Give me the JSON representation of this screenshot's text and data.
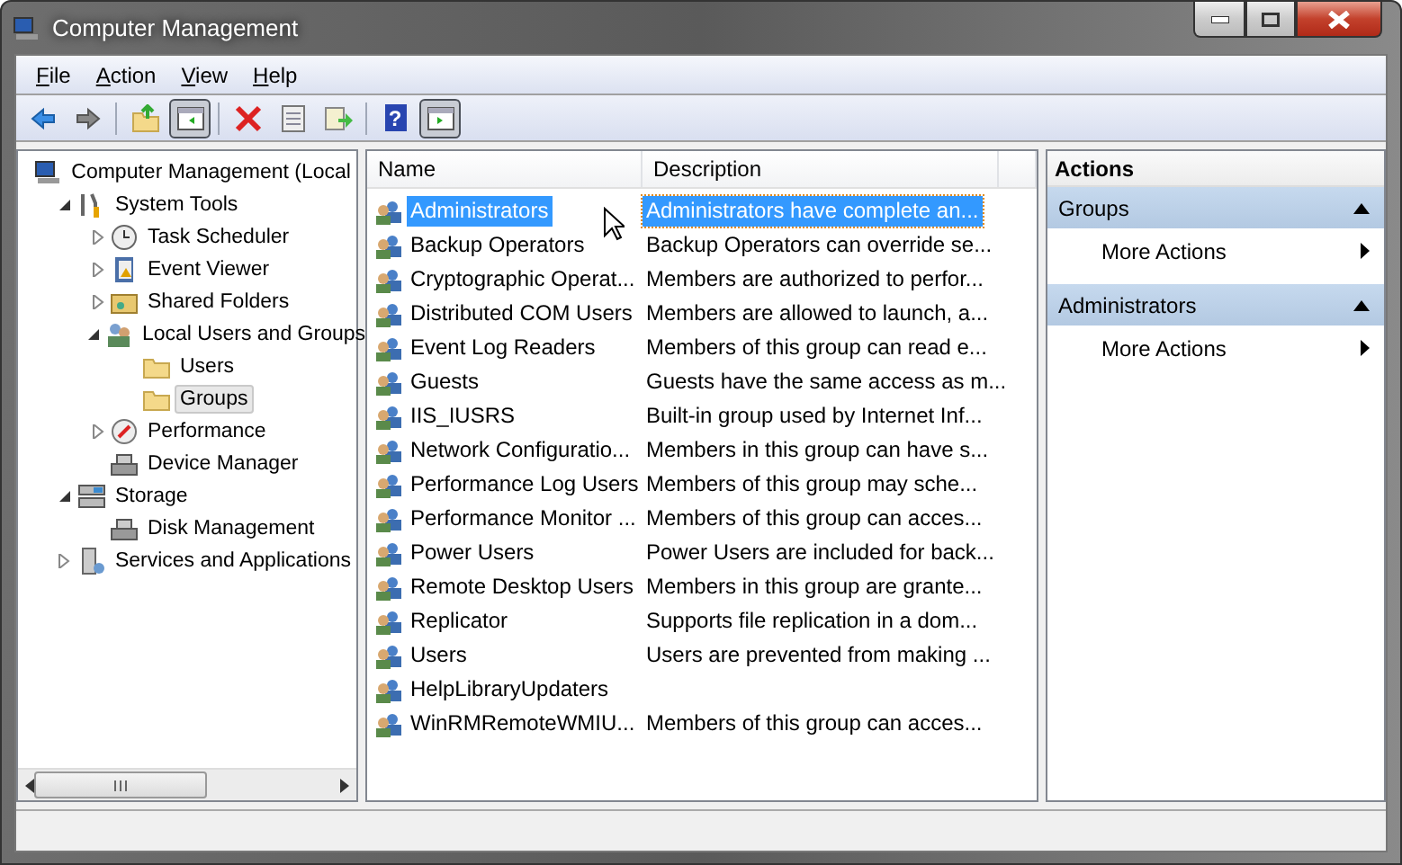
{
  "window": {
    "title": "Computer Management"
  },
  "menu": [
    {
      "label": "File"
    },
    {
      "label": "Action"
    },
    {
      "label": "View"
    },
    {
      "label": "Help"
    }
  ],
  "toolbar": [
    {
      "kind": "back",
      "pressed": false
    },
    {
      "kind": "forward",
      "pressed": false
    },
    {
      "kind": "sep"
    },
    {
      "kind": "up",
      "pressed": false
    },
    {
      "kind": "tree-pane",
      "pressed": true
    },
    {
      "kind": "sep"
    },
    {
      "kind": "delete",
      "pressed": false
    },
    {
      "kind": "properties",
      "pressed": false
    },
    {
      "kind": "export",
      "pressed": false
    },
    {
      "kind": "sep"
    },
    {
      "kind": "help",
      "label": "?",
      "pressed": false
    },
    {
      "kind": "action-pane",
      "pressed": true
    }
  ],
  "tree": [
    {
      "label": "Computer Management (Local",
      "kind": "computer",
      "selected": false,
      "children": [
        {
          "label": "System Tools",
          "kind": "tools",
          "expanded": true,
          "selected": false,
          "children": [
            {
              "label": "Task Scheduler",
              "kind": "clock",
              "expanded": false,
              "selected": false
            },
            {
              "label": "Event Viewer",
              "kind": "log",
              "expanded": false,
              "selected": false
            },
            {
              "label": "Shared Folders",
              "kind": "share",
              "expanded": false,
              "selected": false
            },
            {
              "label": "Local Users and Groups",
              "kind": "users",
              "expanded": true,
              "selected": false,
              "children": [
                {
                  "label": "Users",
                  "kind": "folder",
                  "selected": false
                },
                {
                  "label": "Groups",
                  "kind": "folder",
                  "selected": true
                }
              ]
            },
            {
              "label": "Performance",
              "kind": "gauge",
              "expanded": false,
              "selected": false
            },
            {
              "label": "Device Manager",
              "kind": "device",
              "selected": false
            }
          ]
        },
        {
          "label": "Storage",
          "kind": "storage",
          "expanded": true,
          "selected": false,
          "children": [
            {
              "label": "Disk Management",
              "kind": "device",
              "selected": false
            }
          ]
        },
        {
          "label": "Services and Applications",
          "kind": "services",
          "expanded": false,
          "selected": false
        }
      ]
    }
  ],
  "table": {
    "columns": [
      "Name",
      "Description"
    ],
    "rows": [
      {
        "name": "Administrators",
        "description": "Administrators have complete an...",
        "selected": true
      },
      {
        "name": "Backup Operators",
        "description": "Backup Operators can override se...",
        "selected": false
      },
      {
        "name": "Cryptographic Operat...",
        "description": "Members are authorized to perfor...",
        "selected": false
      },
      {
        "name": "Distributed COM Users",
        "description": "Members are allowed to launch, a...",
        "selected": false
      },
      {
        "name": "Event Log Readers",
        "description": "Members of this group can read e...",
        "selected": false
      },
      {
        "name": "Guests",
        "description": "Guests have the same access as m...",
        "selected": false
      },
      {
        "name": "IIS_IUSRS",
        "description": "Built-in group used by Internet Inf...",
        "selected": false
      },
      {
        "name": "Network Configuratio...",
        "description": "Members in this group can have s...",
        "selected": false
      },
      {
        "name": "Performance Log Users",
        "description": "Members of this group may sche...",
        "selected": false
      },
      {
        "name": "Performance Monitor ...",
        "description": "Members of this group can acces...",
        "selected": false
      },
      {
        "name": "Power Users",
        "description": "Power Users are included for back...",
        "selected": false
      },
      {
        "name": "Remote Desktop Users",
        "description": "Members in this group are grante...",
        "selected": false
      },
      {
        "name": "Replicator",
        "description": "Supports file replication in a dom...",
        "selected": false
      },
      {
        "name": "Users",
        "description": "Users are prevented from making ...",
        "selected": false
      },
      {
        "name": "HelpLibraryUpdaters",
        "selected": false
      },
      {
        "name": "WinRMRemoteWMIU...",
        "description": "Members of this group can acces...",
        "selected": false
      }
    ]
  },
  "actions": {
    "title": "Actions",
    "sections": [
      {
        "title": "Groups",
        "expanded": true,
        "items": [
          "More Actions"
        ]
      },
      {
        "title": "Administrators",
        "expanded": true,
        "items": [
          "More Actions"
        ]
      }
    ]
  }
}
